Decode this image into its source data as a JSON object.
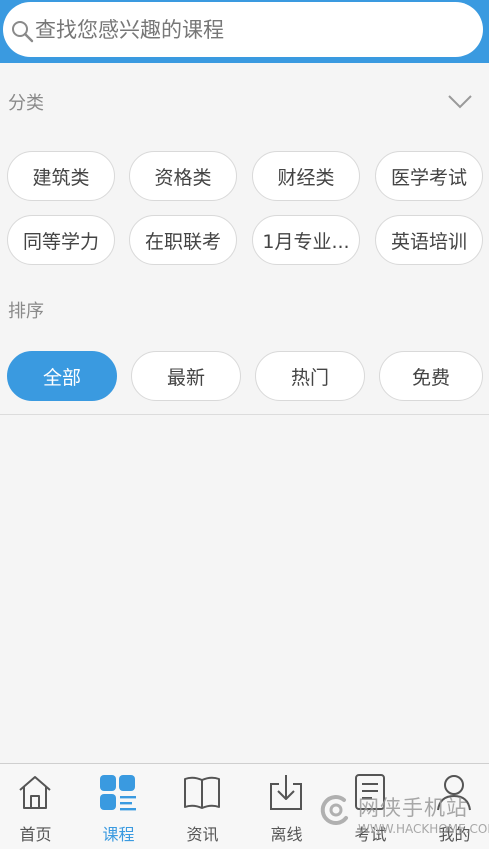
{
  "search": {
    "placeholder": "查找您感兴趣的课程"
  },
  "category": {
    "label": "分类",
    "chips": [
      "建筑类",
      "资格类",
      "财经类",
      "医学考试",
      "同等学力",
      "在职联考",
      "1月专业...",
      "英语培训"
    ]
  },
  "sort": {
    "label": "排序",
    "chips": [
      "全部",
      "最新",
      "热门",
      "免费"
    ],
    "active_index": 0
  },
  "tabs": [
    {
      "label": "首页",
      "icon": "home-icon"
    },
    {
      "label": "课程",
      "icon": "course-grid-icon",
      "active": true
    },
    {
      "label": "资讯",
      "icon": "book-icon"
    },
    {
      "label": "离线",
      "icon": "download-icon"
    },
    {
      "label": "考试",
      "icon": "exam-paper-icon"
    },
    {
      "label": "我的",
      "icon": "user-icon"
    }
  ],
  "watermark": {
    "title": "网侠手机站",
    "url": "WWW.HACKHOME.COM"
  },
  "colors": {
    "accent": "#3a9ae0",
    "background": "#f5f5f5",
    "chip_border": "#d9d9d9"
  }
}
